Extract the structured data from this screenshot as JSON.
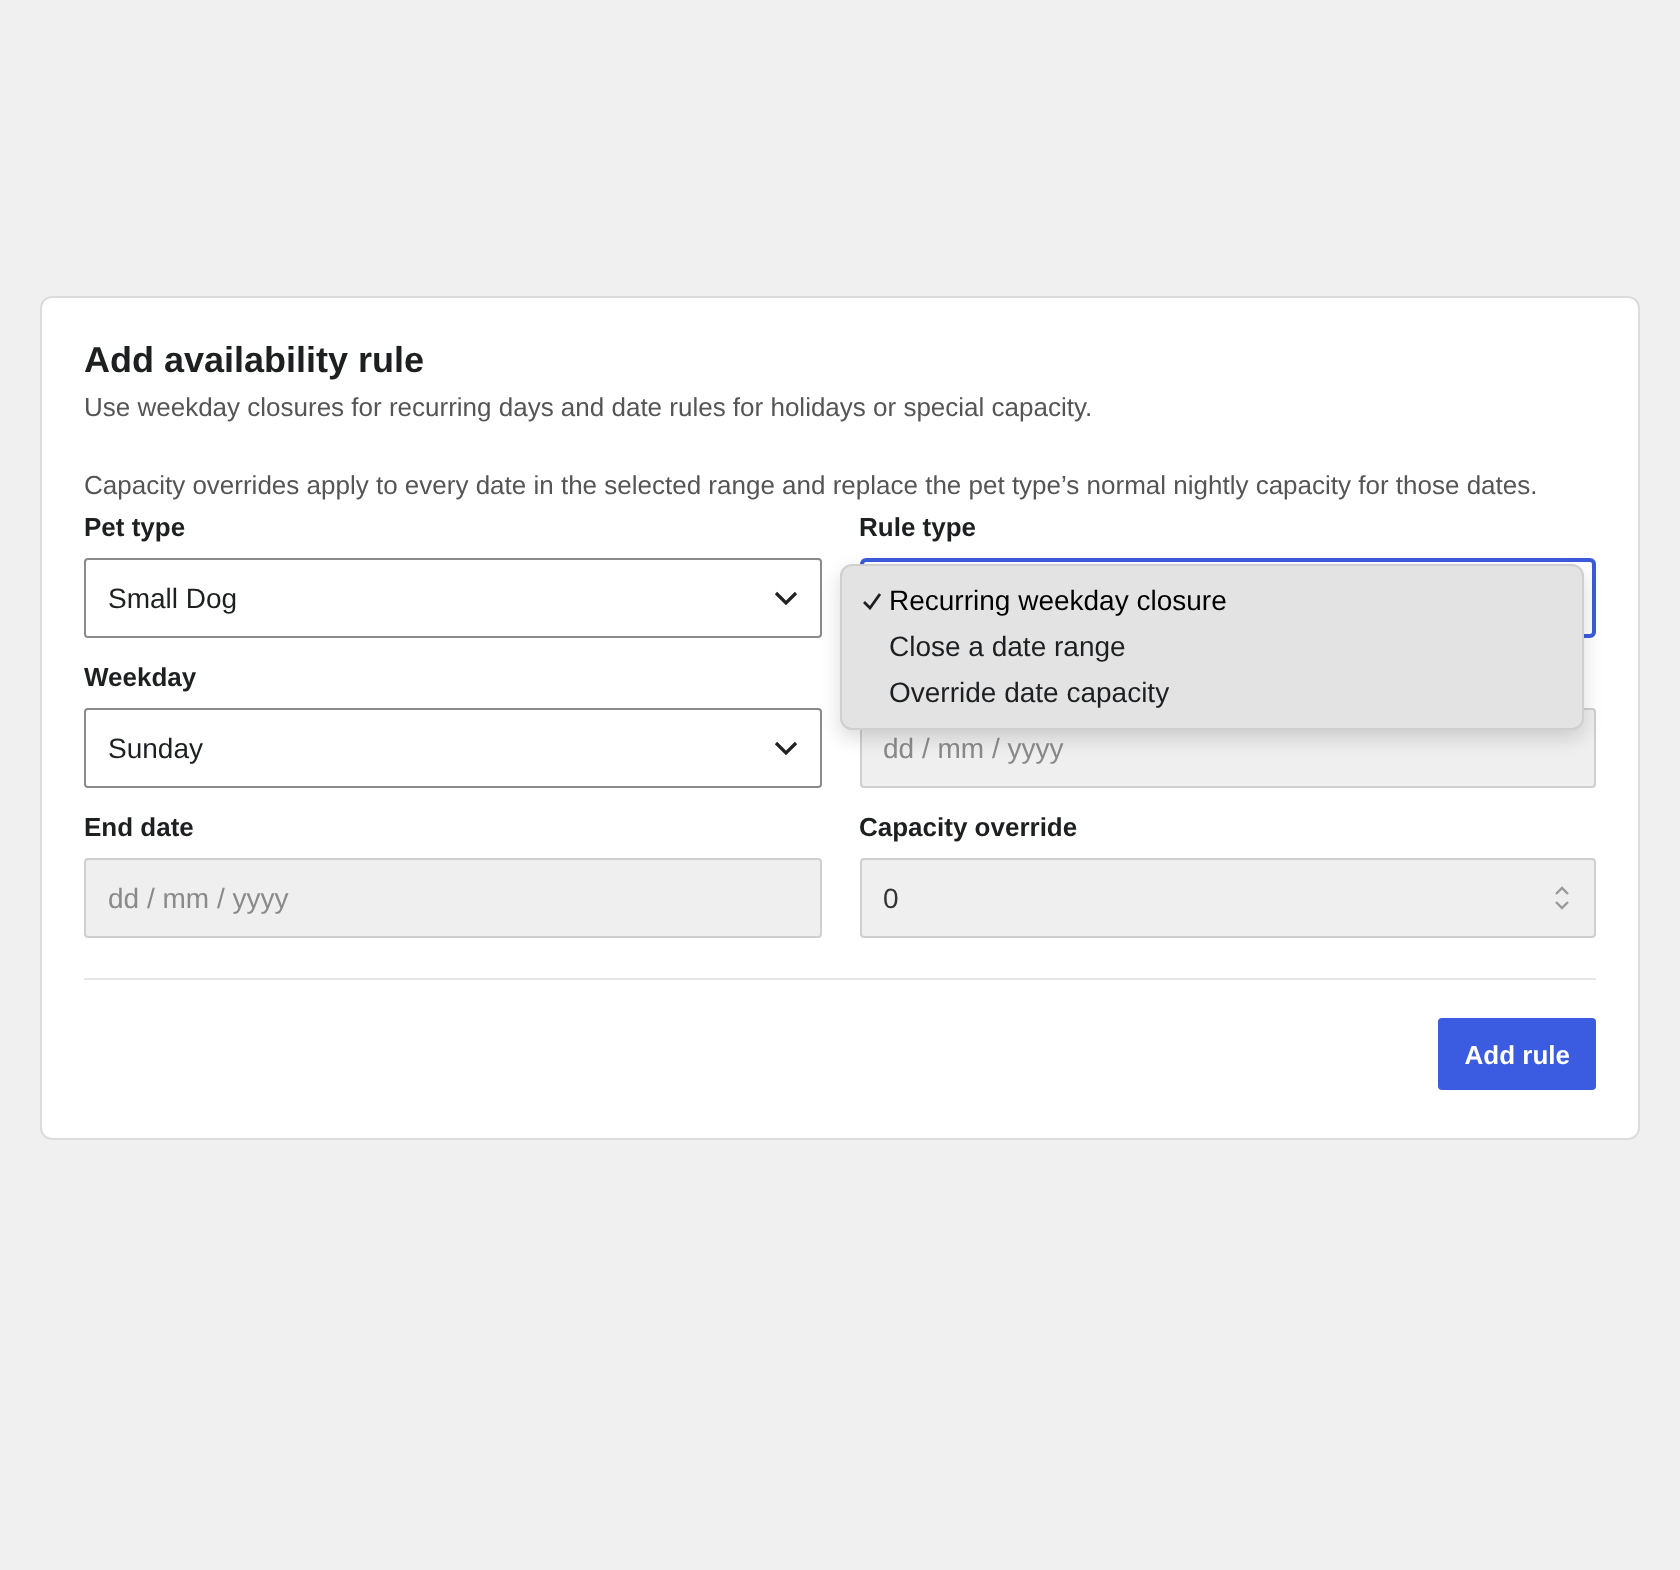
{
  "card": {
    "title": "Add availability rule",
    "subtitle": "Use weekday closures for recurring days and date rules for holidays or special capacity.",
    "note": "Capacity overrides apply to every date in the selected range and replace the pet type’s normal nightly capacity for those dates.",
    "fields": [
      {
        "kind": "select",
        "label": "Pet type",
        "value": "Small Dog",
        "disabled": false,
        "focused": false
      },
      {
        "kind": "select",
        "label": "Rule type",
        "disabled": false,
        "focused": true,
        "menu": [
          {
            "label": "Recurring weekday closure",
            "selected": true
          },
          {
            "label": "Close a date range",
            "selected": false
          },
          {
            "label": "Override date capacity",
            "selected": false
          }
        ]
      },
      {
        "kind": "select",
        "label": "Weekday",
        "value": "Sunday",
        "disabled": false,
        "focused": false
      },
      {
        "kind": "date",
        "placeholder": "dd / mm / yyyy",
        "disabled": true,
        "focused": false
      },
      {
        "kind": "date",
        "label": "End date",
        "placeholder": "dd / mm / yyyy",
        "disabled": true,
        "focused": false
      },
      {
        "kind": "number",
        "label": "Capacity override",
        "value": "0",
        "disabled": true,
        "focused": false
      }
    ],
    "button": "Add rule"
  }
}
